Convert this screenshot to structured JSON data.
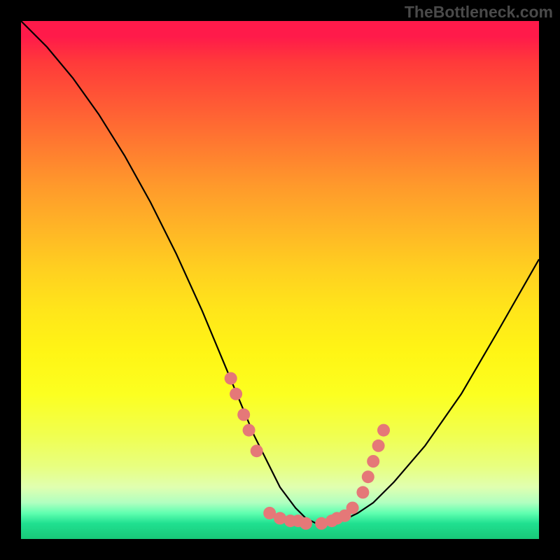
{
  "watermark": "TheBottleneck.com",
  "chart_data": {
    "type": "line",
    "title": "",
    "xlabel": "",
    "ylabel": "",
    "xlim": [
      0,
      100
    ],
    "ylim": [
      0,
      100
    ],
    "curve": {
      "description": "V-shaped bottleneck curve, steep descent from top-left, minimum near x=58, gentle rise to right",
      "x": [
        0,
        5,
        10,
        15,
        20,
        25,
        30,
        35,
        40,
        45,
        50,
        53,
        55,
        57,
        60,
        63,
        65,
        68,
        72,
        78,
        85,
        92,
        100
      ],
      "y": [
        100,
        95,
        89,
        82,
        74,
        65,
        55,
        44,
        32,
        20,
        10,
        6,
        4,
        3,
        3,
        4,
        5,
        7,
        11,
        18,
        28,
        40,
        54
      ]
    },
    "markers": {
      "description": "Pink/salmon dots clustered near the curve minimum region",
      "color": "#e57878",
      "points": [
        {
          "x": 40.5,
          "y": 31
        },
        {
          "x": 41.5,
          "y": 28
        },
        {
          "x": 43,
          "y": 24
        },
        {
          "x": 44,
          "y": 21
        },
        {
          "x": 45.5,
          "y": 17
        },
        {
          "x": 48,
          "y": 5
        },
        {
          "x": 50,
          "y": 4
        },
        {
          "x": 52,
          "y": 3.5
        },
        {
          "x": 53.5,
          "y": 3.5
        },
        {
          "x": 55,
          "y": 3
        },
        {
          "x": 58,
          "y": 3
        },
        {
          "x": 60,
          "y": 3.5
        },
        {
          "x": 61,
          "y": 4
        },
        {
          "x": 62.5,
          "y": 4.5
        },
        {
          "x": 64,
          "y": 6
        },
        {
          "x": 66,
          "y": 9
        },
        {
          "x": 67,
          "y": 12
        },
        {
          "x": 68,
          "y": 15
        },
        {
          "x": 69,
          "y": 18
        },
        {
          "x": 70,
          "y": 21
        }
      ]
    },
    "gradient_colors": {
      "top": "#ff1a4a",
      "middle": "#ffe61a",
      "bottom": "#18c878"
    }
  }
}
